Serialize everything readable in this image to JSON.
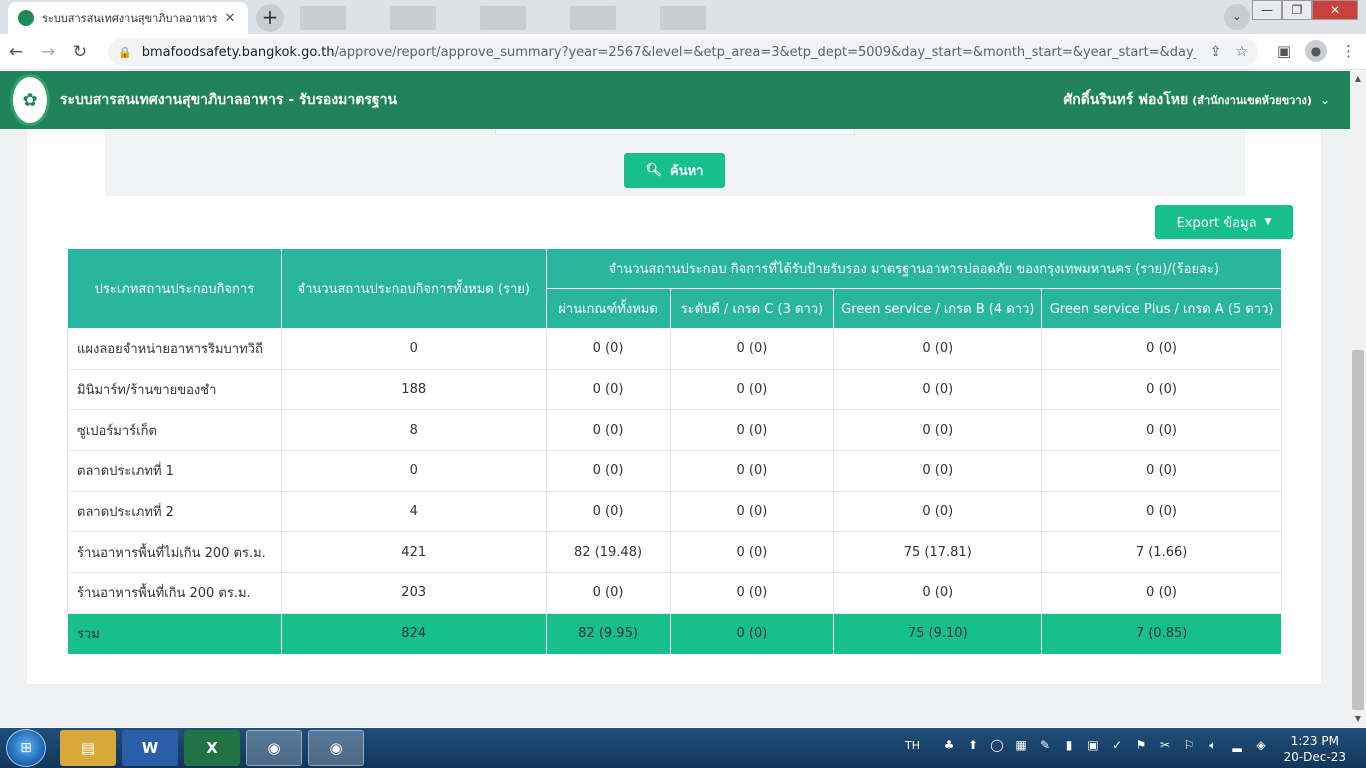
{
  "browser": {
    "tab_title": "ระบบสารสนเทศงานสุขาภิบาลอาหาร",
    "tab_close": "✕",
    "new_tab": "+",
    "url_host": "bmafoodsafety.bangkok.go.th",
    "url_path": "/approve/report/approve_summary?year=2567&level=&etp_area=3&etp_dept=5009&day_start=&month_start=&year_start=&day_end=...",
    "window_controls": {
      "minimize": "—",
      "maximize": "❐",
      "close": "✕"
    }
  },
  "app": {
    "title": "ระบบสารสนเทศงานสุขาภิบาลอาหาร - รับรองมาตรฐาน",
    "user_name": "ศักดิ์นรินทร์ ฟองโหย",
    "user_dept": "(สำนักงานเขตห้วยขวาง)"
  },
  "search": {
    "button_label": "ค้นหา"
  },
  "export": {
    "button_label": "Export ข้อมูล"
  },
  "table": {
    "headers": {
      "type": "ประเภทสถานประกอบกิจการ",
      "total": "จำนวนสถานประกอบกิจการทั้งหมด (ราย)",
      "group": "จำนวนสถานประกอบ กิจการที่ได้รับป้ายรับรอง มาตรฐานอาหารปลอดภัย ของกรุงเทพมหานคร (ราย)/(ร้อยละ)",
      "passed": "ผ่านเกณฑ์ทั้งหมด",
      "level_c": "ระดับดี / เกรด C (3 ดาว)",
      "level_b": "Green service / เกรด B (4 ดาว)",
      "level_a": "Green service Plus / เกรด A (5 ดาว)"
    },
    "rows": [
      {
        "type": "แผงลอยจำหน่ายอาหารริมบาทวิถี",
        "total": "0",
        "passed": "0 (0)",
        "c": "0 (0)",
        "b": "0 (0)",
        "a": "0 (0)"
      },
      {
        "type": "มินิมาร์ท/ร้านขายของชำ",
        "total": "188",
        "passed": "0 (0)",
        "c": "0 (0)",
        "b": "0 (0)",
        "a": "0 (0)"
      },
      {
        "type": "ซูเปอร์มาร์เก็ต",
        "total": "8",
        "passed": "0 (0)",
        "c": "0 (0)",
        "b": "0 (0)",
        "a": "0 (0)"
      },
      {
        "type": "ตลาดประเภทที่ 1",
        "total": "0",
        "passed": "0 (0)",
        "c": "0 (0)",
        "b": "0 (0)",
        "a": "0 (0)"
      },
      {
        "type": "ตลาดประเภทที่ 2",
        "total": "4",
        "passed": "0 (0)",
        "c": "0 (0)",
        "b": "0 (0)",
        "a": "0 (0)"
      },
      {
        "type": "ร้านอาหารพื้นที่ไม่เกิน 200 ตร.ม.",
        "total": "421",
        "passed": "82 (19.48)",
        "c": "0 (0)",
        "b": "75 (17.81)",
        "a": "7 (1.66)"
      },
      {
        "type": "ร้านอาหารพื้นที่เกิน 200 ตร.ม.",
        "total": "203",
        "passed": "0 (0)",
        "c": "0 (0)",
        "b": "0 (0)",
        "a": "0 (0)"
      }
    ],
    "total_row": {
      "type": "รวม",
      "total": "824",
      "passed": "82 (9.95)",
      "c": "0 (0)",
      "b": "75 (9.10)",
      "a": "7 (0.85)"
    }
  },
  "taskbar": {
    "lang": "TH",
    "time": "1:23 PM",
    "date": "20-Dec-23",
    "apps": [
      "explorer",
      "word",
      "excel",
      "chrome",
      "chrome"
    ]
  },
  "colors": {
    "header_green": "#20835a",
    "table_header": "#29b69e",
    "accent": "#17bf8a"
  }
}
